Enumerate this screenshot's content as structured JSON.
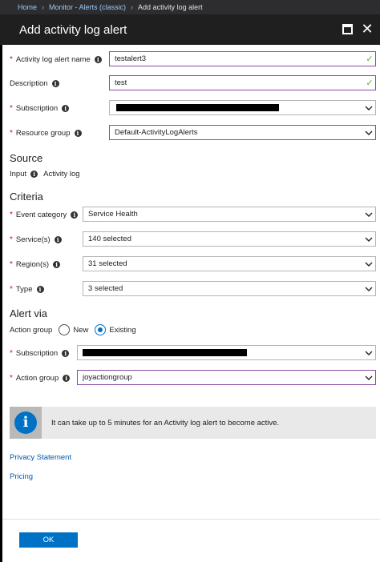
{
  "breadcrumb": {
    "home": "Home",
    "monitor": "Monitor - Alerts (classic)",
    "current": "Add activity log alert"
  },
  "blade": {
    "title": "Add activity log alert",
    "maximize_icon": "maximize-icon",
    "close_icon": "close-icon",
    "close_glyph": "✕"
  },
  "form": {
    "alert_name_label": "Activity log alert name",
    "alert_name_value": "testalert3",
    "description_label": "Description",
    "description_value": "test",
    "subscription_label": "Subscription",
    "resource_group_label": "Resource group",
    "resource_group_value": "Default-ActivityLogAlerts",
    "required_marker": "*",
    "info_glyph": "i",
    "valid_glyph": "✓"
  },
  "source": {
    "heading": "Source",
    "input_label": "Input",
    "input_value": "Activity log"
  },
  "criteria": {
    "heading": "Criteria",
    "event_category_label": "Event category",
    "event_category_value": "Service Health",
    "services_label": "Service(s)",
    "services_value": "140 selected",
    "regions_label": "Region(s)",
    "regions_value": "31 selected",
    "type_label": "Type",
    "type_value": "3 selected"
  },
  "alert_via": {
    "heading": "Alert via",
    "action_group_label": "Action group",
    "option_new": "New",
    "option_existing": "Existing",
    "selected_option": "Existing",
    "subscription_label": "Subscription",
    "action_group_field_label": "Action group",
    "action_group_value": "joyactiongroup"
  },
  "banner": {
    "message": "It can take up to 5 minutes for an Activity log alert to become active.",
    "icon_glyph": "i"
  },
  "links": {
    "privacy": "Privacy Statement",
    "pricing": "Pricing"
  },
  "footer": {
    "ok_label": "OK"
  },
  "colors": {
    "accent": "#0072c6",
    "focus_border": "#8a4aa8",
    "required": "#c8102e",
    "valid": "#5fae3c",
    "header_bg": "#1f1f1f"
  }
}
